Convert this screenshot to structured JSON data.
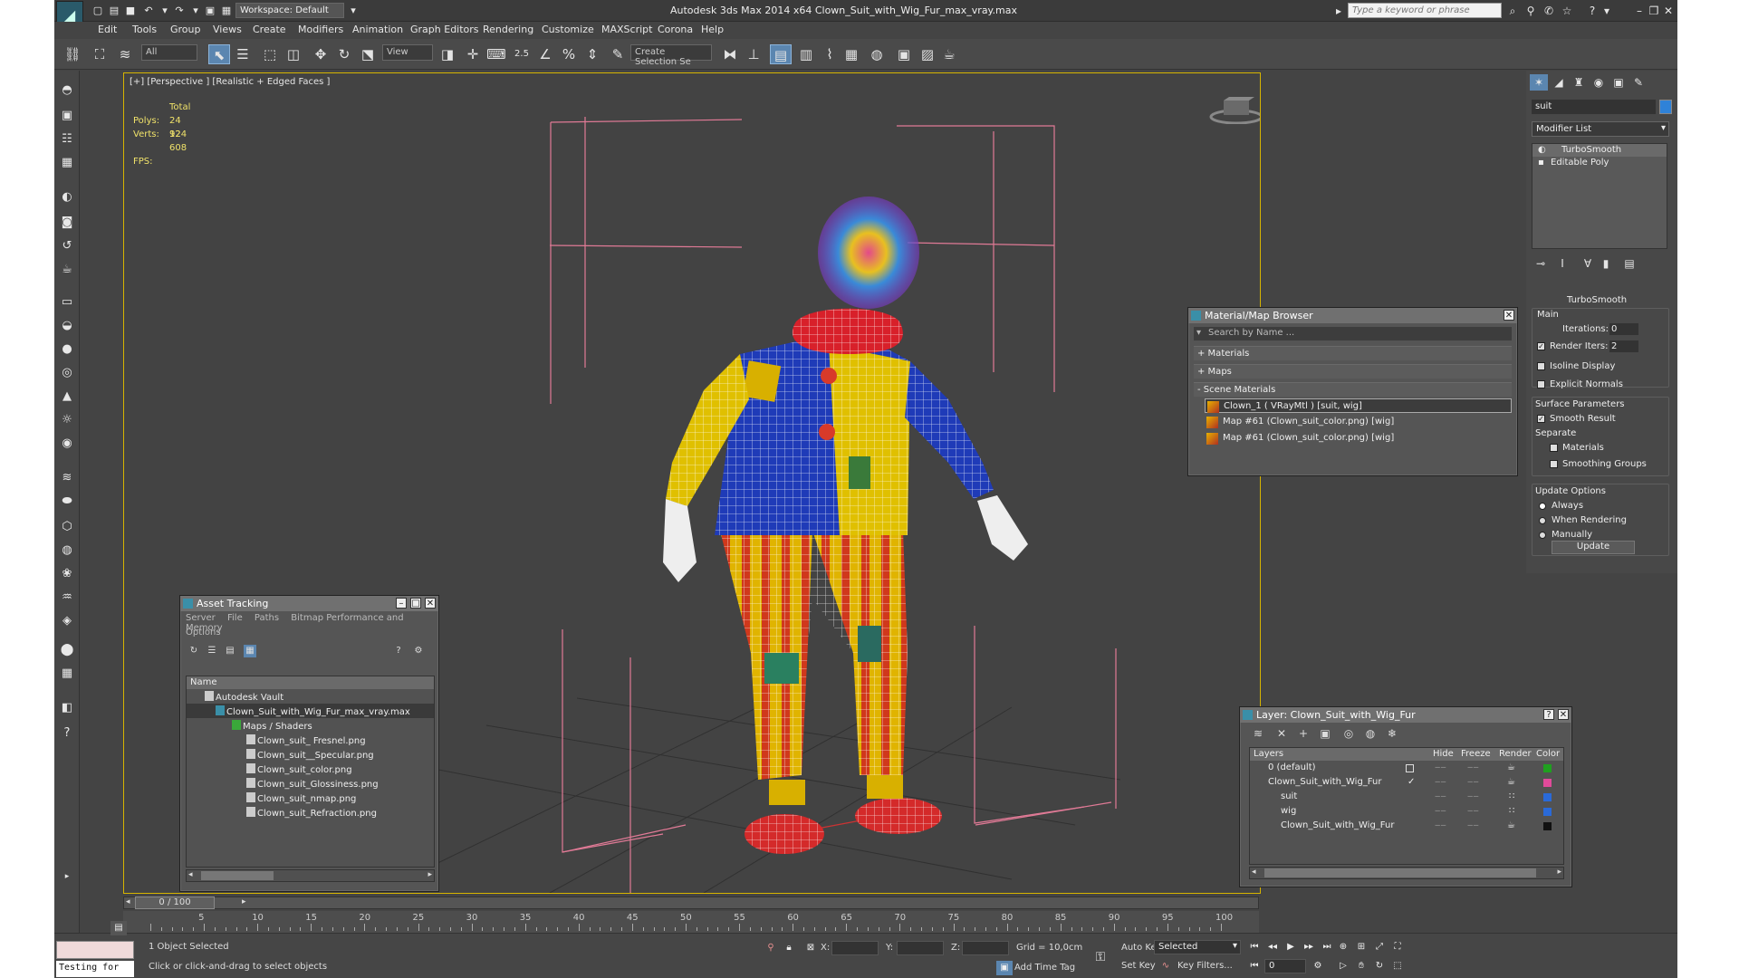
{
  "titlebar": {
    "workspace": "Workspace: Default",
    "title": "Autodesk 3ds Max  2014 x64      Clown_Suit_with_Wig_Fur_max_vray.max",
    "search_placeholder": "Type a keyword or phrase"
  },
  "menu": [
    "Edit",
    "Tools",
    "Group",
    "Views",
    "Create",
    "Modifiers",
    "Animation",
    "Graph Editors",
    "Rendering",
    "Customize",
    "MAXScript",
    "Corona",
    "Help"
  ],
  "toolbar": {
    "filter": "All",
    "refcoord": "View",
    "snap_label": "2.5",
    "selection_set": "Create Selection Se"
  },
  "viewport": {
    "label": "[+] [Perspective ] [Realistic + Edged Faces ]",
    "stats_total": "Total",
    "polys_label": "Polys:",
    "polys": "24 924",
    "verts_label": "Verts:",
    "verts": "12 608",
    "fps_label": "FPS:"
  },
  "material_browser": {
    "title": "Material/Map Browser",
    "search_placeholder": "Search by Name ...",
    "sections": [
      "+ Materials",
      "+ Maps",
      "- Scene Materials"
    ],
    "items": [
      "Clown_1  ( VRayMtl ) [suit, wig]",
      "Map #61 (Clown_suit_color.png) [wig]",
      "Map #61 (Clown_suit_color.png) [wig]"
    ]
  },
  "asset_tracking": {
    "title": "Asset Tracking",
    "menu": [
      "Server",
      "File",
      "Paths",
      "Bitmap Performance and Memory"
    ],
    "menu2": "Options",
    "column": "Name",
    "rows": [
      "Autodesk Vault",
      "Clown_Suit_with_Wig_Fur_max_vray.max",
      "Maps / Shaders",
      "Clown_suit_ Fresnel.png",
      "Clown_suit__Specular.png",
      "Clown_suit_color.png",
      "Clown_suit_Glossiness.png",
      "Clown_suit_nmap.png",
      "Clown_suit_Refraction.png"
    ]
  },
  "layers": {
    "title": "Layer: Clown_Suit_with_Wig_Fur",
    "columns": [
      "Layers",
      "Hide",
      "Freeze",
      "Render",
      "Color"
    ],
    "rows": [
      {
        "name": "0 (default)",
        "color": "#1fa01f"
      },
      {
        "name": "Clown_Suit_with_Wig_Fur",
        "color": "#e04a9a"
      },
      {
        "name": "suit",
        "color": "#2a6ad8"
      },
      {
        "name": "wig",
        "color": "#2a6ad8"
      },
      {
        "name": "Clown_Suit_with_Wig_Fur",
        "color": "#111111"
      }
    ]
  },
  "command_panel": {
    "object_name": "suit",
    "modifier_list": "Modifier List",
    "stack": [
      "TurboSmooth",
      "Editable Poly"
    ],
    "rollout_title": "TurboSmooth",
    "main": "Main",
    "iterations_label": "Iterations:",
    "iterations": "0",
    "render_iters_label": "Render Iters:",
    "render_iters": "2",
    "isoline": "Isoline Display",
    "explicit_normals": "Explicit Normals",
    "surface_params": "Surface Parameters",
    "smooth_result": "Smooth Result",
    "separate": "Separate",
    "materials": "Materials",
    "smoothing_groups": "Smoothing Groups",
    "update_options": "Update Options",
    "always": "Always",
    "when_rendering": "When Rendering",
    "manually": "Manually",
    "update_button": "Update"
  },
  "timeline": {
    "frame": "0 / 100",
    "ticks": [
      "5",
      "10",
      "15",
      "20",
      "25",
      "30",
      "35",
      "40",
      "45",
      "50",
      "55",
      "60",
      "65",
      "70",
      "75",
      "80",
      "85",
      "90",
      "95",
      "100"
    ]
  },
  "status": {
    "maxscript": "Testing for",
    "selected": "1 Object Selected",
    "prompt": "Click or click-and-drag to select objects",
    "x_label": "X:",
    "y_label": "Y:",
    "z_label": "Z:",
    "grid": "Grid = 10,0cm",
    "add_time_tag": "Add Time Tag",
    "auto_key": "Auto Key",
    "selected_set": "Selected",
    "set_key": "Set Key",
    "key_filters": "Key Filters...",
    "current_frame": "0"
  }
}
